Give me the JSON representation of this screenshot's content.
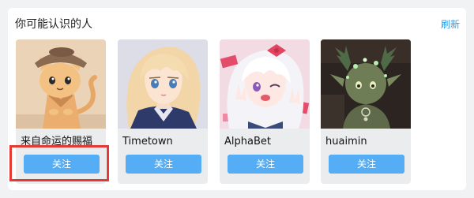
{
  "header": {
    "title": "你可能认识的人",
    "refresh_label": "刷新"
  },
  "users": [
    {
      "name": "来自命运的赐福",
      "follow_label": "关注",
      "avatar_icon": "cartoon-cat-avatar",
      "avatar_bg": "#e9d2b4"
    },
    {
      "name": "Timetown",
      "follow_label": "关注",
      "avatar_icon": "anime-blonde-avatar",
      "avatar_bg": "#d9dbe8"
    },
    {
      "name": "AlphaBet",
      "follow_label": "关注",
      "avatar_icon": "anime-white-hair-avatar",
      "avatar_bg": "#f2dbe3"
    },
    {
      "name": "huaimin",
      "follow_label": "关注",
      "avatar_icon": "dark-creature-avatar",
      "avatar_bg": "#2a2320"
    }
  ],
  "colors": {
    "accent": "#55adf5",
    "link": "#2f9ce8",
    "highlight": "#e53935"
  }
}
